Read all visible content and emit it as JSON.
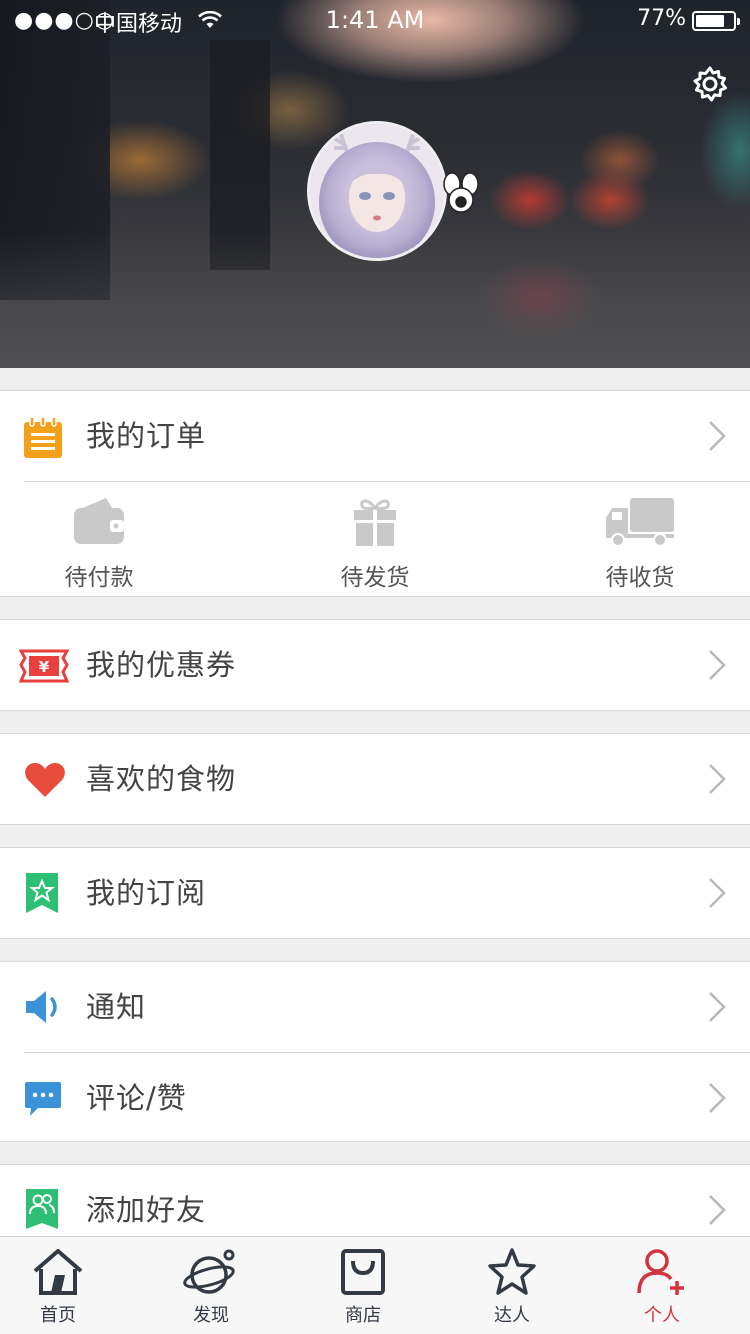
{
  "status_bar": {
    "signal": "●●●○○",
    "carrier": "中国移动",
    "time": "1:41 AM",
    "battery_percent": "77%",
    "battery_level": 0.77
  },
  "header": {
    "settings_icon": "gear-icon",
    "avatar_icon": "user-avatar",
    "gender_icon": "female-symbol-icon"
  },
  "orders": {
    "title": "我的订单",
    "items": [
      {
        "label": "待付款",
        "icon": "wallet-icon"
      },
      {
        "label": "待发货",
        "icon": "gift-icon"
      },
      {
        "label": "待收货",
        "icon": "truck-icon"
      }
    ]
  },
  "menu": {
    "coupons": {
      "label": "我的优惠券",
      "icon": "coupon-icon",
      "color": "#e8403c"
    },
    "favorites": {
      "label": "喜欢的食物",
      "icon": "heart-icon",
      "color": "#e84c3d"
    },
    "subscriptions": {
      "label": "我的订阅",
      "icon": "bookmark-star-icon",
      "color": "#2dbf74"
    },
    "notifications": {
      "label": "通知",
      "icon": "speaker-icon",
      "color": "#3a93d8"
    },
    "comments": {
      "label": "评论/赞",
      "icon": "chat-bubble-icon",
      "color": "#3a93d8"
    },
    "add_friends": {
      "label": "添加好友",
      "icon": "friends-icon",
      "color": "#2dbf74"
    }
  },
  "tabbar": {
    "tabs": [
      {
        "label": "首页",
        "icon": "home-icon"
      },
      {
        "label": "发现",
        "icon": "planet-icon"
      },
      {
        "label": "商店",
        "icon": "shopping-bag-icon"
      },
      {
        "label": "达人",
        "icon": "star-icon"
      },
      {
        "label": "个人",
        "icon": "add-user-icon"
      }
    ],
    "active_color": "#d2333e",
    "inactive_color": "#333a45"
  },
  "colors": {
    "order_icon": "#f5a01a",
    "subicon_gray": "#c9c9c9",
    "chevron": "#b8b8b8"
  }
}
